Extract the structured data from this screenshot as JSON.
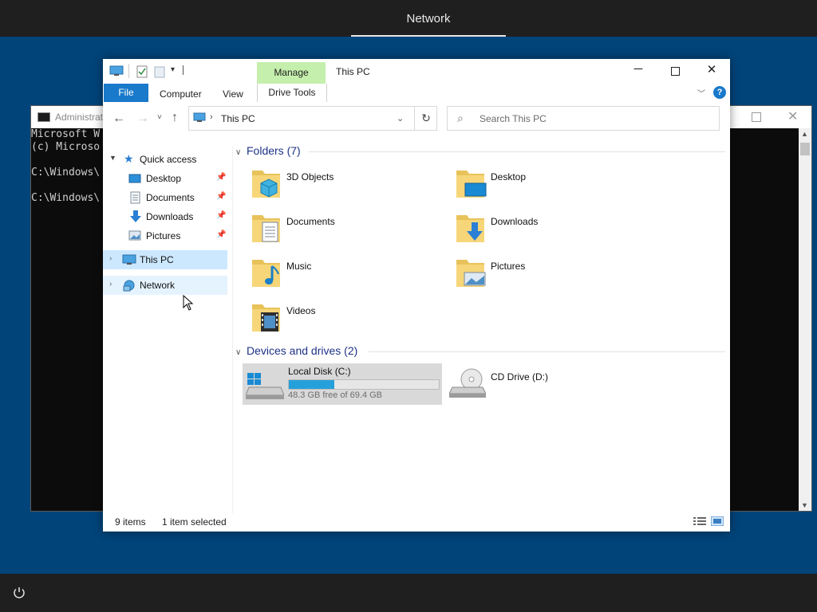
{
  "topbar": {
    "title": "Network"
  },
  "cmd": {
    "title": "Administrat",
    "lines": [
      "Microsoft W",
      "(c) Microso",
      "",
      "C:\\Windows\\",
      "",
      "C:\\Windows\\"
    ]
  },
  "ribbon": {
    "manage_header": "Manage",
    "window_title": "This PC",
    "tabs": {
      "file": "File",
      "computer": "Computer",
      "view": "View",
      "drive_tools": "Drive Tools"
    }
  },
  "address": {
    "path": "This PC"
  },
  "search": {
    "placeholder": "Search This PC"
  },
  "nav_pane": {
    "quick_access": "Quick access",
    "quick_items": [
      {
        "label": "Desktop",
        "icon": "desktop-icon"
      },
      {
        "label": "Documents",
        "icon": "documents-icon"
      },
      {
        "label": "Downloads",
        "icon": "downloads-icon"
      },
      {
        "label": "Pictures",
        "icon": "pictures-icon"
      }
    ],
    "this_pc": "This PC",
    "network": "Network"
  },
  "content": {
    "folders_header": "Folders (7)",
    "folders": [
      {
        "label": "3D Objects",
        "icon": "3d-objects-icon"
      },
      {
        "label": "Desktop",
        "icon": "desktop-folder-icon"
      },
      {
        "label": "Documents",
        "icon": "documents-folder-icon"
      },
      {
        "label": "Downloads",
        "icon": "downloads-folder-icon"
      },
      {
        "label": "Music",
        "icon": "music-folder-icon"
      },
      {
        "label": "Pictures",
        "icon": "pictures-folder-icon"
      },
      {
        "label": "Videos",
        "icon": "videos-folder-icon"
      }
    ],
    "devices_header": "Devices and drives (2)",
    "drives": [
      {
        "label": "Local Disk (C:)",
        "free_text": "48.3 GB free of 69.4 GB",
        "used_fraction": 0.304
      },
      {
        "label": "CD Drive (D:)"
      }
    ]
  },
  "status": {
    "items": "9 items",
    "selected": "1 item selected"
  },
  "colors": {
    "desktop": "#00447a",
    "accent": "#1979ca",
    "manage": "#c5efac",
    "selection": "#cce8ff",
    "drive_fill": "#26a0da"
  }
}
